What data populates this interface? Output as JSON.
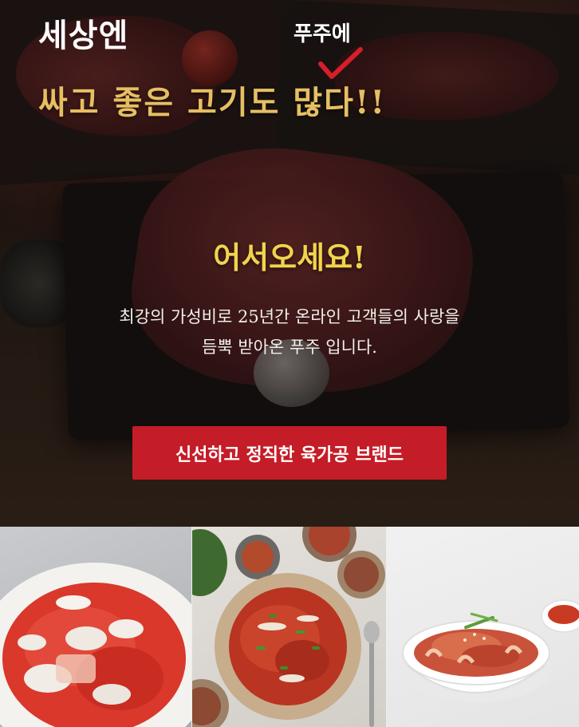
{
  "hero": {
    "headline_small": "세상엔",
    "handwritten_note": "푸주에",
    "headline_big": "싸고 좋은 고기도 많다!!",
    "welcome": "어서오세요!",
    "description_line1": "최강의 가성비로 25년간 온라인 고객들의 사랑을",
    "description_line2": "듬뿍 받아온 푸주 입니다.",
    "cta_label": "신선하고 정직한 육가공 브랜드",
    "check_icon": "checkmark-icon",
    "colors": {
      "headline_gold": "#e6bf63",
      "welcome_yellow": "#f2d44c",
      "cta_red": "#c41d28",
      "check_red": "#d81e2a"
    }
  },
  "products": [
    {
      "image": "spicy-pork-squid-dish"
    },
    {
      "image": "stir-fried-spicy-pork-with-sides"
    },
    {
      "image": "spicy-pork-bowl"
    }
  ]
}
